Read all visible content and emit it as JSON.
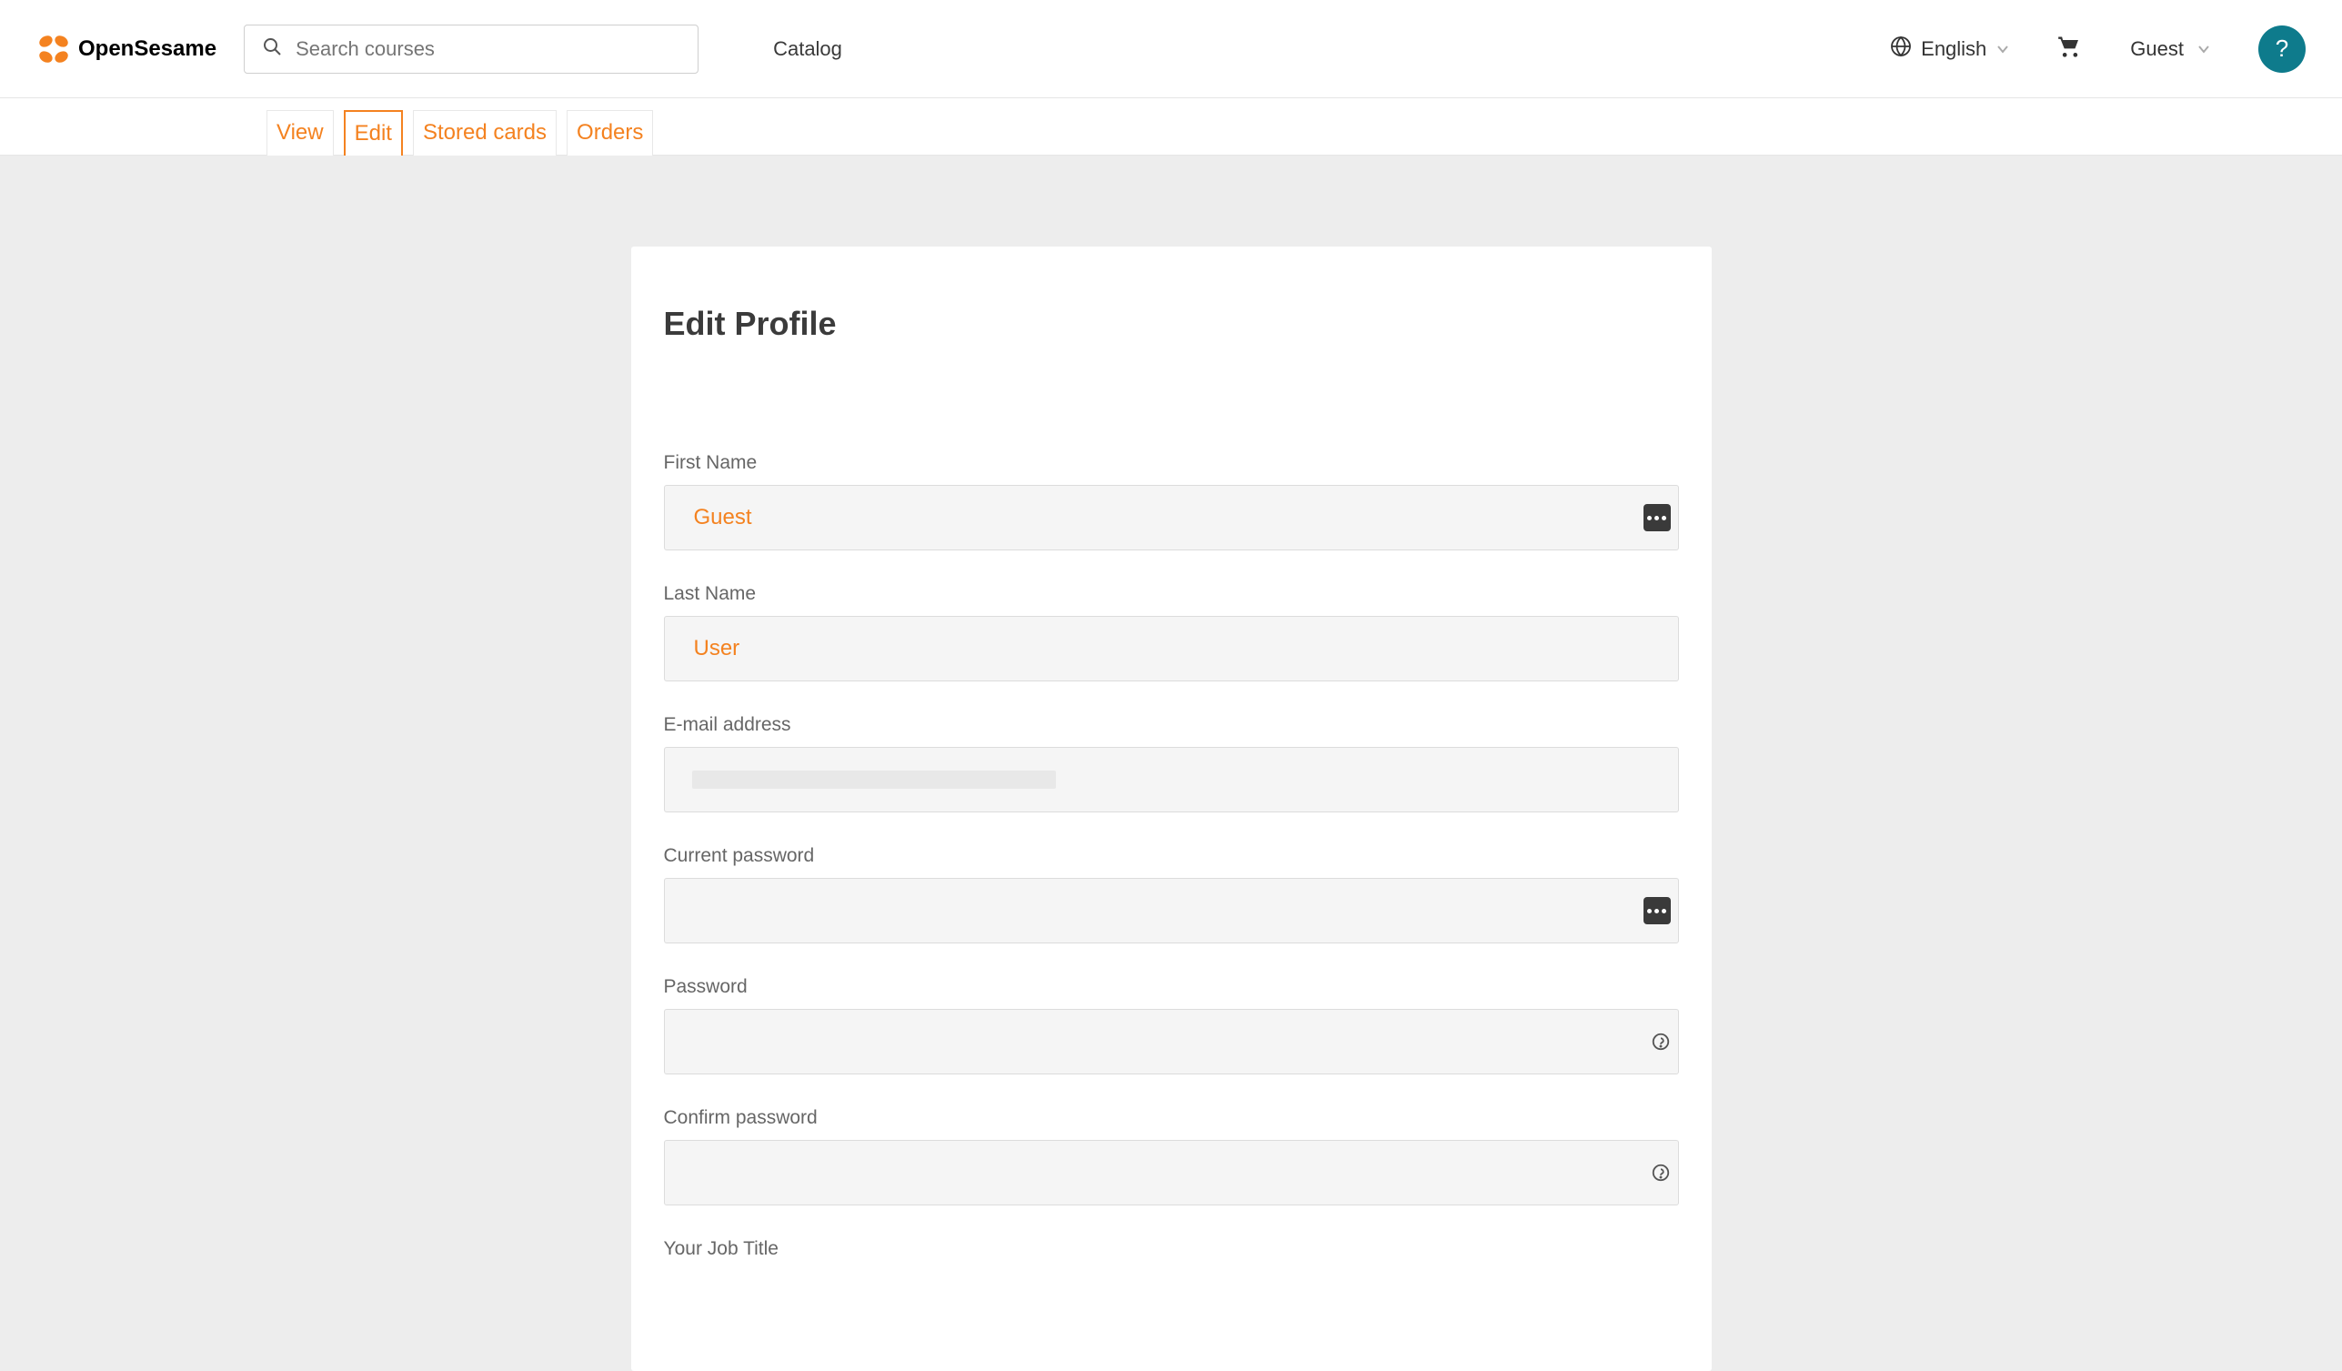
{
  "brand": {
    "name": "OpenSesame"
  },
  "header": {
    "search_placeholder": "Search courses",
    "catalog_label": "Catalog",
    "language_label": "English",
    "user_label": "Guest",
    "help_symbol": "?"
  },
  "tabs": {
    "view": "View",
    "edit": "Edit",
    "cards": "Stored cards",
    "orders": "Orders",
    "active": "edit"
  },
  "page": {
    "title": "Edit Profile"
  },
  "form": {
    "first_name": {
      "label": "First Name",
      "value": "Guest"
    },
    "last_name": {
      "label": "Last Name",
      "value": "User"
    },
    "email": {
      "label": "E-mail address",
      "value": ""
    },
    "current_password": {
      "label": "Current password",
      "value": ""
    },
    "password": {
      "label": "Password",
      "value": ""
    },
    "confirm_password": {
      "label": "Confirm password",
      "value": ""
    },
    "job_title": {
      "label": "Your Job Title",
      "value": ""
    }
  }
}
